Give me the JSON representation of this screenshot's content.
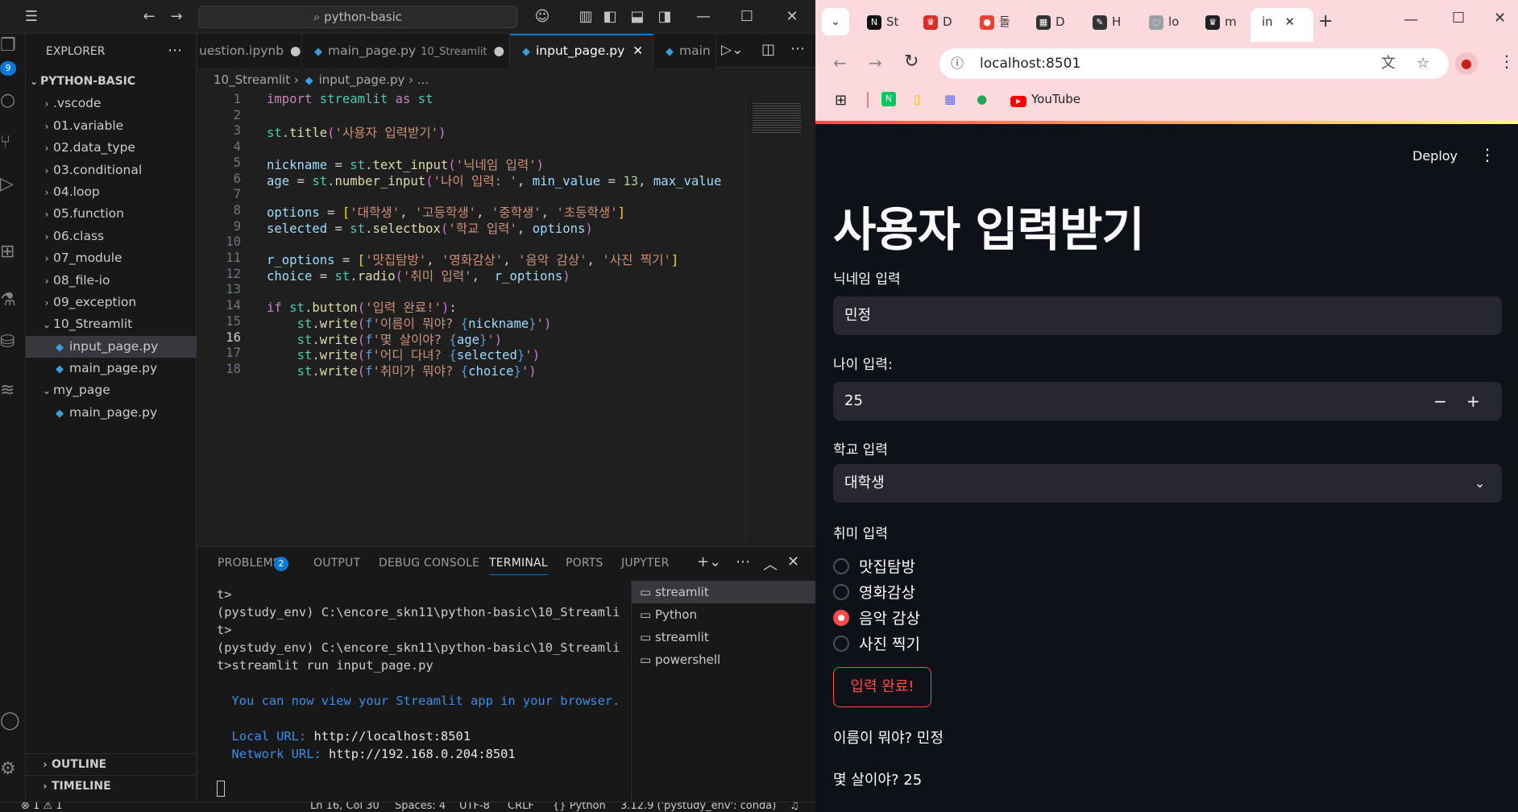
{
  "vscode": {
    "search": "python-basic",
    "explorer_title": "EXPLORER",
    "root": "PYTHON-BASIC",
    "badge_count": "9",
    "tree": [
      {
        "label": ".vscode",
        "type": "folder",
        "open": false,
        "indent": 1
      },
      {
        "label": "01.variable",
        "type": "folder",
        "open": false,
        "indent": 1
      },
      {
        "label": "02.data_type",
        "type": "folder",
        "open": false,
        "indent": 1
      },
      {
        "label": "03.conditional",
        "type": "folder",
        "open": false,
        "indent": 1
      },
      {
        "label": "04.loop",
        "type": "folder",
        "open": false,
        "indent": 1
      },
      {
        "label": "05.function",
        "type": "folder",
        "open": false,
        "indent": 1
      },
      {
        "label": "06.class",
        "type": "folder",
        "open": false,
        "indent": 1
      },
      {
        "label": "07_module",
        "type": "folder",
        "open": false,
        "indent": 1
      },
      {
        "label": "08_file-io",
        "type": "folder",
        "open": false,
        "indent": 1
      },
      {
        "label": "09_exception",
        "type": "folder",
        "open": false,
        "indent": 1
      },
      {
        "label": "10_Streamlit",
        "type": "folder",
        "open": true,
        "indent": 1
      },
      {
        "label": "input_page.py",
        "type": "file",
        "indent": 2,
        "selected": true
      },
      {
        "label": "main_page.py",
        "type": "file",
        "indent": 2
      },
      {
        "label": "my_page",
        "type": "folder",
        "open": true,
        "indent": 1
      },
      {
        "label": "main_page.py",
        "type": "file",
        "indent": 2
      }
    ],
    "outline": "OUTLINE",
    "timeline": "TIMELINE",
    "tabs": [
      {
        "label": "uestion.ipynb",
        "sub": "",
        "dot": true
      },
      {
        "label": "main_page.py",
        "sub": "10_Streamlit",
        "dot": true
      },
      {
        "label": "input_page.py",
        "sub": "",
        "active": true
      },
      {
        "label": "main",
        "sub": ""
      }
    ],
    "breadcrumb": {
      "folder": "10_Streamlit",
      "file": "input_page.py",
      "rest": "..."
    },
    "code_lines": [
      "import streamlit as st",
      "",
      "st.title('사용자 입력받기')",
      "",
      "nickname = st.text_input('닉네임 입력')",
      "age = st.number_input('나이 입력: ', min_value = 13, max_value",
      "",
      "options = ['대학생', '고등학생', '중학생', '초등학생']",
      "selected = st.selectbox('학교 입력', options)",
      "",
      "r_options = ['맛집탐방', '영화감상', '음악 감상', '사진 찍기']",
      "choice = st.radio('취미 입력',  r_options)",
      "",
      "if st.button('입력 완료!'):",
      "    st.write(f'이름이 뭐야? {nickname}')",
      "    st.write(f'몇 살이야? {age}')",
      "    st.write(f'어디 다녀? {selected}')",
      "    st.write(f'취미가 뭐야? {choice}')"
    ],
    "panel_tabs": [
      "PROBLEMS",
      "OUTPUT",
      "DEBUG CONSOLE",
      "TERMINAL",
      "PORTS",
      "JUPYTER"
    ],
    "problems_count": "2",
    "terminal": {
      "lines": [
        "t>",
        "(pystudy_env) C:\\encore_skn11\\python-basic\\10_Streamli",
        "t>",
        "(pystudy_env) C:\\encore_skn11\\python-basic\\10_Streamli",
        "t>streamlit run input_page.py",
        "",
        "  You can now view your Streamlit app in your browser.",
        ""
      ],
      "local_label": "  Local URL:",
      "local_url": " http://localhost:8501",
      "network_label": "  Network URL:",
      "network_url": " http://192.168.0.204:8501"
    },
    "terminal_list": [
      "streamlit",
      "Python",
      "streamlit",
      "powershell"
    ],
    "status": {
      "errors": "1",
      "warnings": "1",
      "cursor": "Ln 16, Col 30",
      "spaces": "Spaces: 4",
      "encoding": "UTF-8",
      "eol": "CRLF",
      "lang": "Python",
      "interp": "3.12.9 ('pystudy_env': conda)"
    }
  },
  "browser": {
    "tabs": [
      {
        "label": "St",
        "fav": "N",
        "color": "#111111"
      },
      {
        "label": "D",
        "fav": "♛",
        "color": "#d93025"
      },
      {
        "label": "돌",
        "fav": "●",
        "color": "#ea4335"
      },
      {
        "label": "D",
        "fav": "▦",
        "color": "#333333"
      },
      {
        "label": "H",
        "fav": "✎",
        "color": "#333333"
      },
      {
        "label": "lo",
        "fav": "◌",
        "color": "#9aa0a6"
      },
      {
        "label": "m",
        "fav": "♛",
        "color": "#202124"
      },
      {
        "label": "in",
        "fav": "",
        "color": "#ffffff",
        "active": true
      }
    ],
    "url": "localhost:8501",
    "bookmark_youtube": "YouTube",
    "accent": "#ff4b4b"
  },
  "app": {
    "deploy": "Deploy",
    "title": "사용자 입력받기",
    "nickname_label": "닉네임 입력",
    "nickname_value": "민정",
    "age_label": "나이 입력:",
    "age_value": "25",
    "school_label": "학교 입력",
    "school_value": "대학생",
    "hobby_label": "취미 입력",
    "hobby_options": [
      "맛집탐방",
      "영화감상",
      "음악 감상",
      "사진 찍기"
    ],
    "hobby_selected": 2,
    "button": "입력 완료!",
    "out1": "이름이 뭐야? 민정",
    "out2": "몇 살이야? 25"
  }
}
